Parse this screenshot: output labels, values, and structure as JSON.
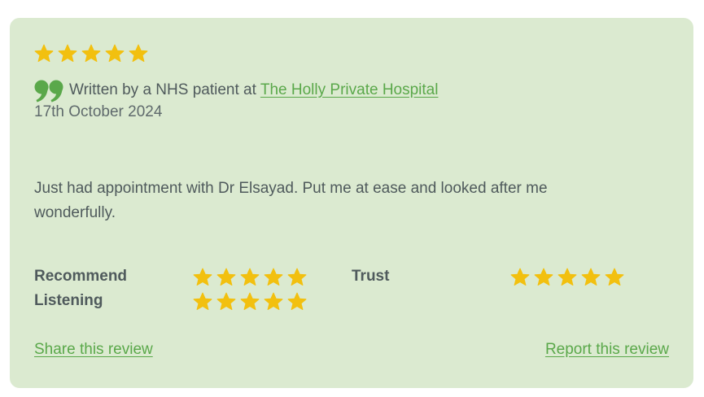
{
  "review": {
    "overall_rating": 5,
    "written_prefix": "Written by a NHS patient at",
    "hospital_name": "The Holly Private Hospital",
    "date": "17th October 2024",
    "text": "Just had appointment with Dr Elsayad. Put me at ease and looked after me wonderfully."
  },
  "ratings": [
    {
      "label": "Recommend",
      "stars": 5
    },
    {
      "label": "Trust",
      "stars": 5
    },
    {
      "label": "Listening",
      "stars": 5
    }
  ],
  "links": {
    "share": "Share this review",
    "report": "Report this review"
  },
  "colors": {
    "card_background": "#dbead0",
    "star": "#f2c00f",
    "link": "#5aa84a",
    "text": "#4f5a5c"
  },
  "icons": {
    "star": "star-icon",
    "quote": "quote-icon"
  }
}
